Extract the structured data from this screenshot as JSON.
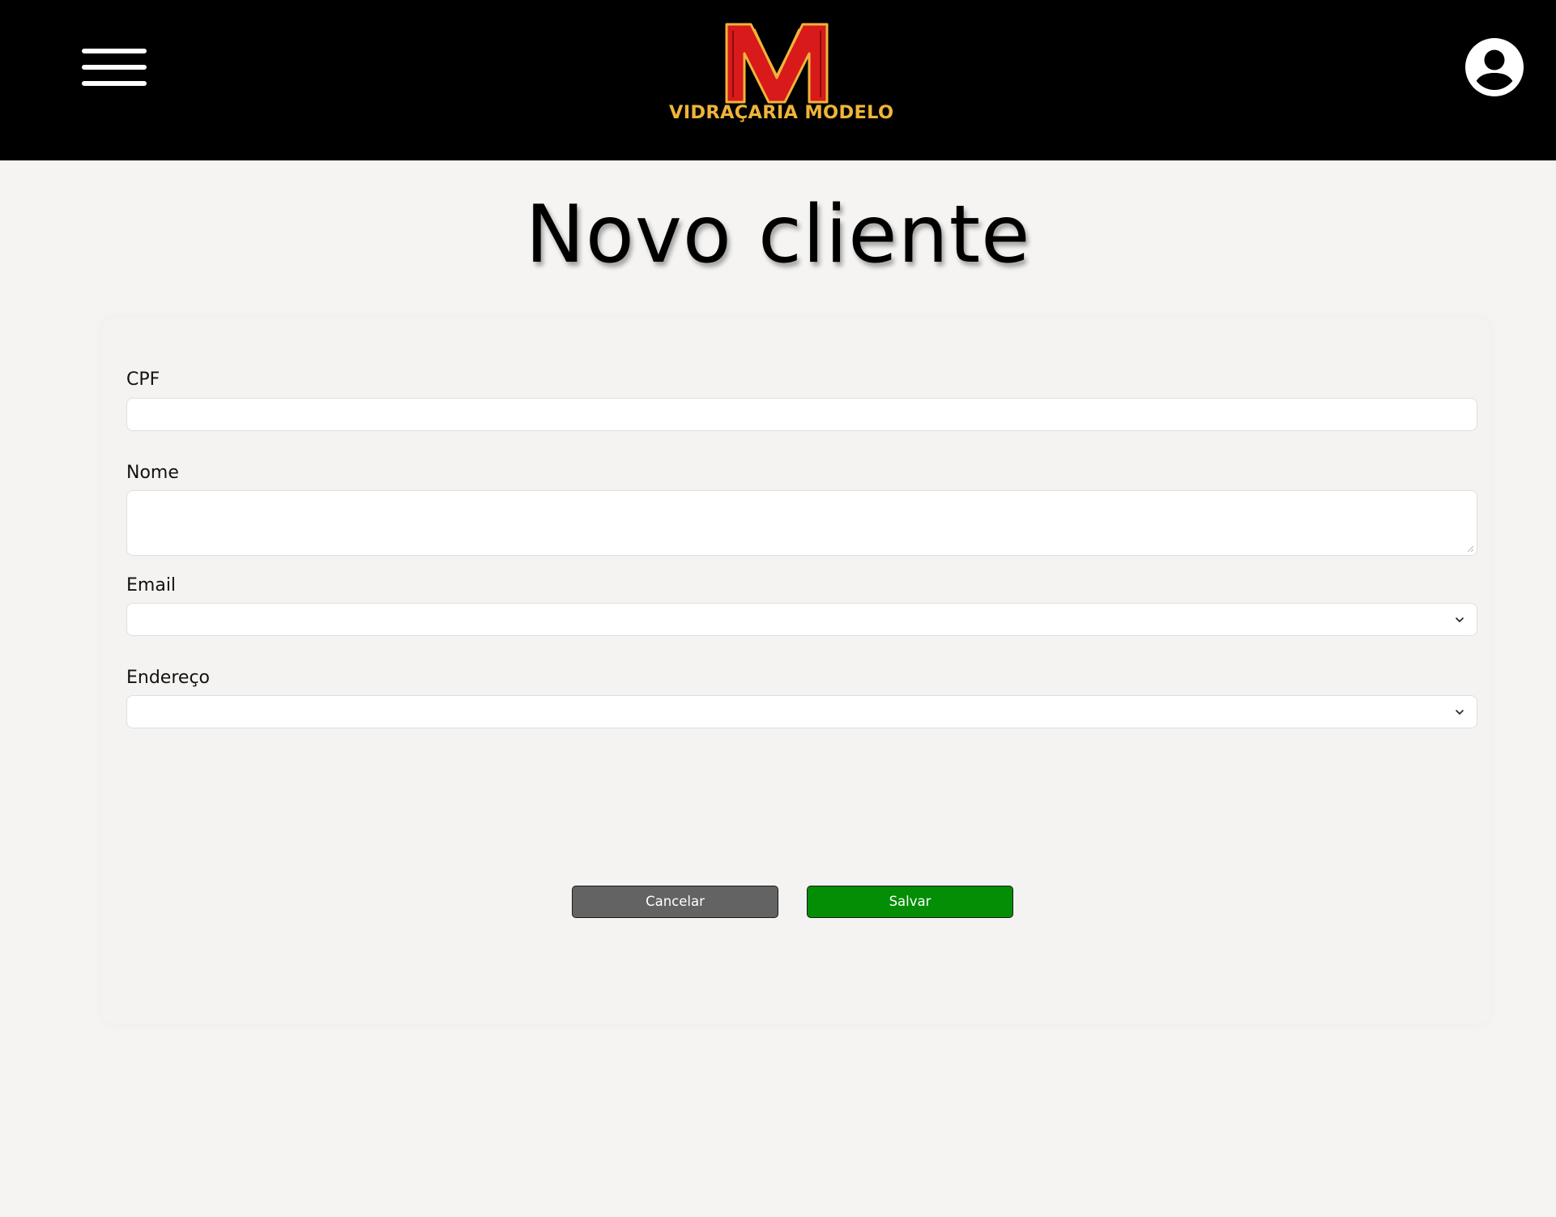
{
  "header": {
    "brand_name": "VIDRAÇARIA MODELO",
    "brand_logo_letter": "M",
    "colors": {
      "background": "#000000",
      "logo_red": "#d81a1a",
      "logo_gold": "#f0b43a"
    },
    "icons": {
      "menu": "hamburger-menu-icon",
      "user": "user-avatar-icon"
    }
  },
  "page": {
    "title": "Novo cliente",
    "background": "#f5f4f2"
  },
  "form": {
    "fields": [
      {
        "label": "CPF",
        "type": "text",
        "value": ""
      },
      {
        "label": "Nome",
        "type": "textarea",
        "value": ""
      },
      {
        "label": "Email",
        "type": "select",
        "value": ""
      },
      {
        "label": "Endereço",
        "type": "select",
        "value": ""
      }
    ],
    "buttons": {
      "cancel_label": "Cancelar",
      "save_label": "Salvar",
      "cancel_color": "#636363",
      "save_color": "#038e05"
    }
  }
}
